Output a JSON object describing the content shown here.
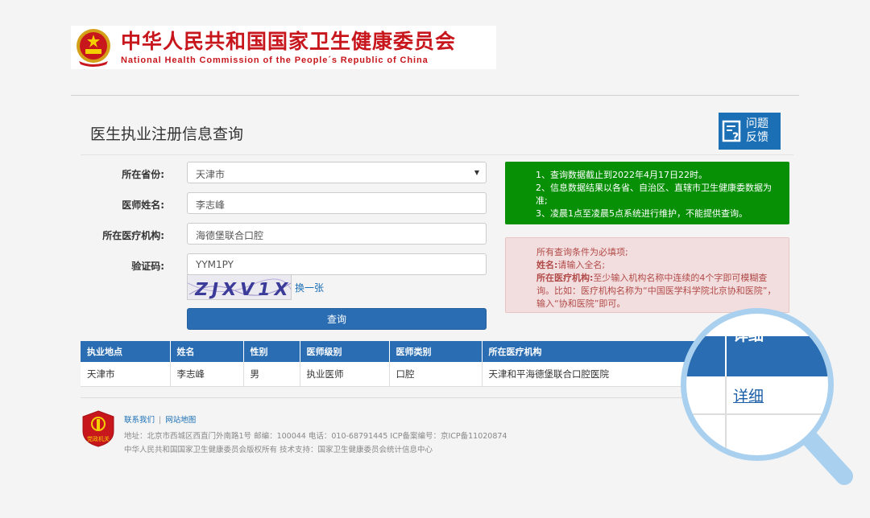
{
  "header": {
    "org_cn": "中华人民共和国国家卫生健康委员会",
    "org_en": "National Health Commission of the People´s Republic of China"
  },
  "page": {
    "title": "医生执业注册信息查询",
    "feedback_line1": "问题",
    "feedback_line2": "反馈"
  },
  "form": {
    "province_label": "所在省份:",
    "province_value": "天津市",
    "name_label": "医师姓名:",
    "name_value": "李志峰",
    "org_label": "所在医疗机构:",
    "org_value": "海德堡联合口腔",
    "captcha_label": "验证码:",
    "captcha_value": "YYM1PY",
    "captcha_image_text": "ZJXV1X",
    "refresh_label": "换一张",
    "submit_label": "查询"
  },
  "notice_green": {
    "line1": "1、查询数据截止到2022年4月17日22时。",
    "line2": "2、信息数据结果以各省、自治区、直辖市卫生健康委数据为准;",
    "line3": "3、凌晨1点至凌晨5点系统进行维护，不能提供查询。"
  },
  "notice_red": {
    "line1": "所有查询条件为必填项;",
    "name_key": "姓名:",
    "name_text": "请输入全名;",
    "org_key": "所在医疗机构:",
    "org_text": "至少输入机构名称中连续的4个字即可模糊查询。比如：医疗机构名称为“中国医学科学院北京协和医院”，输入“协和医院”即可。"
  },
  "table": {
    "headers": [
      "执业地点",
      "姓名",
      "性别",
      "医师级别",
      "医师类别",
      "所在医疗机构"
    ],
    "rows": [
      [
        "天津市",
        "李志峰",
        "男",
        "执业医师",
        "口腔",
        "天津和平海德堡联合口腔医院"
      ]
    ]
  },
  "magnifier": {
    "header_label": "详细",
    "link_label": "详细"
  },
  "footer": {
    "link_contact": "联系我们",
    "link_sitemap": "网站地图",
    "address": "地址：北京市西城区西直门外南路1号   邮编：100044   电话：010-68791445   ICP备案编号：京ICP备11020874",
    "copyright": "中华人民共和国国家卫生健康委员会版权所有   技术支持：国家卫生健康委员会统计信息中心",
    "logo_text": "党政机关"
  },
  "colors": {
    "brand_red": "#c8161d",
    "primary_blue": "#2a6db3",
    "notice_green": "#079006",
    "notice_red_bg": "#f2dede"
  }
}
